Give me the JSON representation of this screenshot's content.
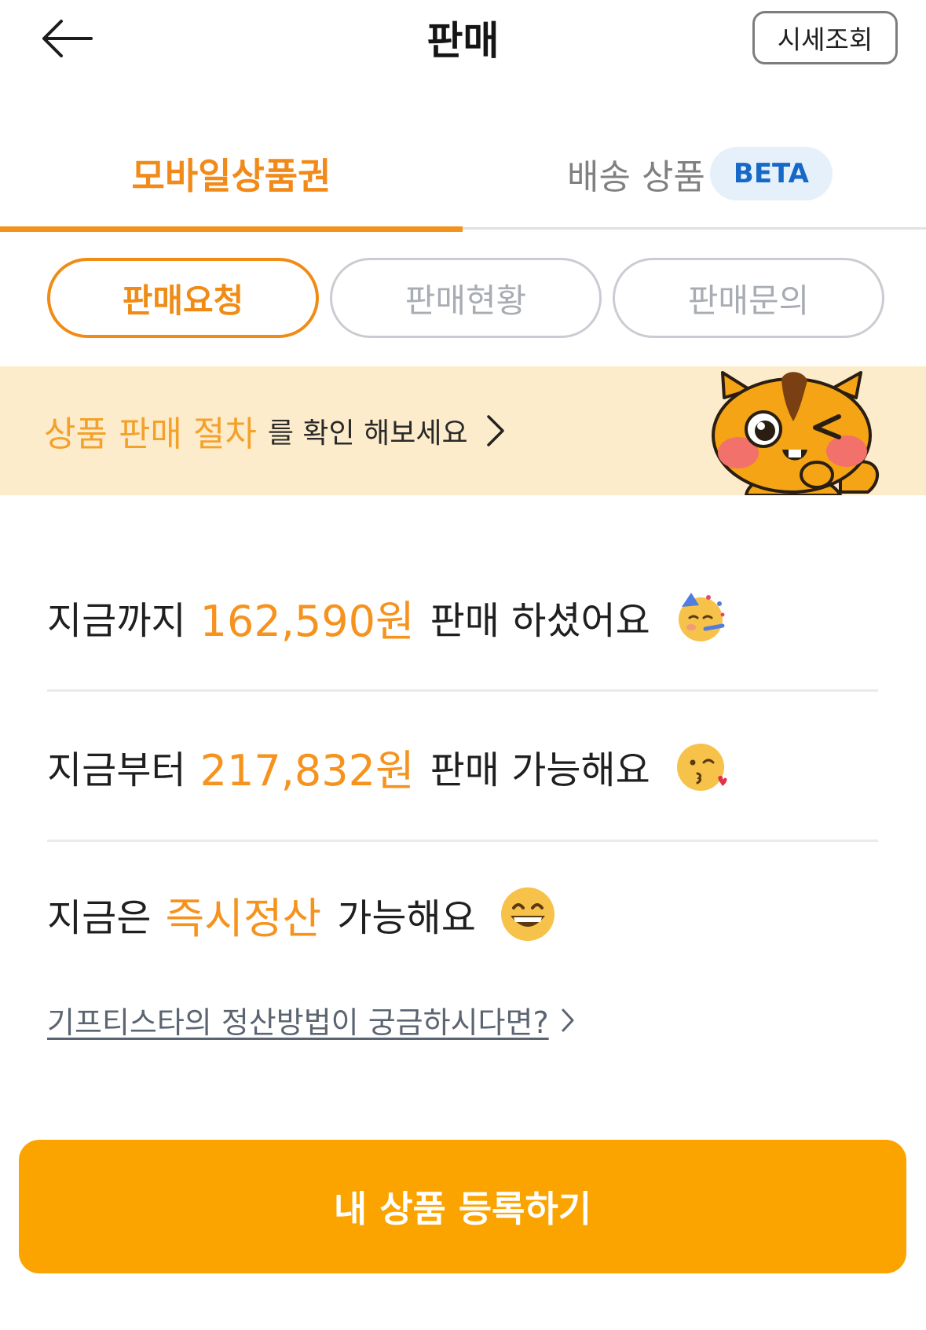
{
  "header": {
    "title": "판매",
    "price_check_label": "시세조회"
  },
  "tabs": [
    {
      "label": "모바일상품권",
      "active": true
    },
    {
      "label": "배송 상품",
      "badge": "BETA",
      "active": false
    }
  ],
  "subtabs": [
    {
      "label": "판매요청",
      "active": true
    },
    {
      "label": "판매현황",
      "active": false
    },
    {
      "label": "판매문의",
      "active": false
    }
  ],
  "guide_banner": {
    "highlight": "상품 판매 절차",
    "text": "를 확인 해보세요"
  },
  "stats": {
    "sold": {
      "prefix": "지금까지",
      "amount": "162,590원",
      "suffix": "판매 하셨어요"
    },
    "available": {
      "prefix": "지금부터",
      "amount": "217,832원",
      "suffix": "판매 가능해요"
    },
    "instant": {
      "prefix": "지금은",
      "amount": "즉시정산",
      "suffix": "가능해요"
    }
  },
  "settle_link": "기프티스타의 정산방법이 궁금하시다면?",
  "register_button": "내 상품 등록하기",
  "colors": {
    "accent": "#f28a1a",
    "button": "#fba400",
    "banner_bg": "#fdeccb",
    "beta_bg": "#e6f0fa",
    "beta_text": "#1769c7"
  },
  "icons": [
    "back-arrow-icon",
    "chevron-right-icon",
    "mascot-squirrel",
    "party-face-emoji",
    "kissing-face-emoji",
    "grinning-face-emoji"
  ]
}
